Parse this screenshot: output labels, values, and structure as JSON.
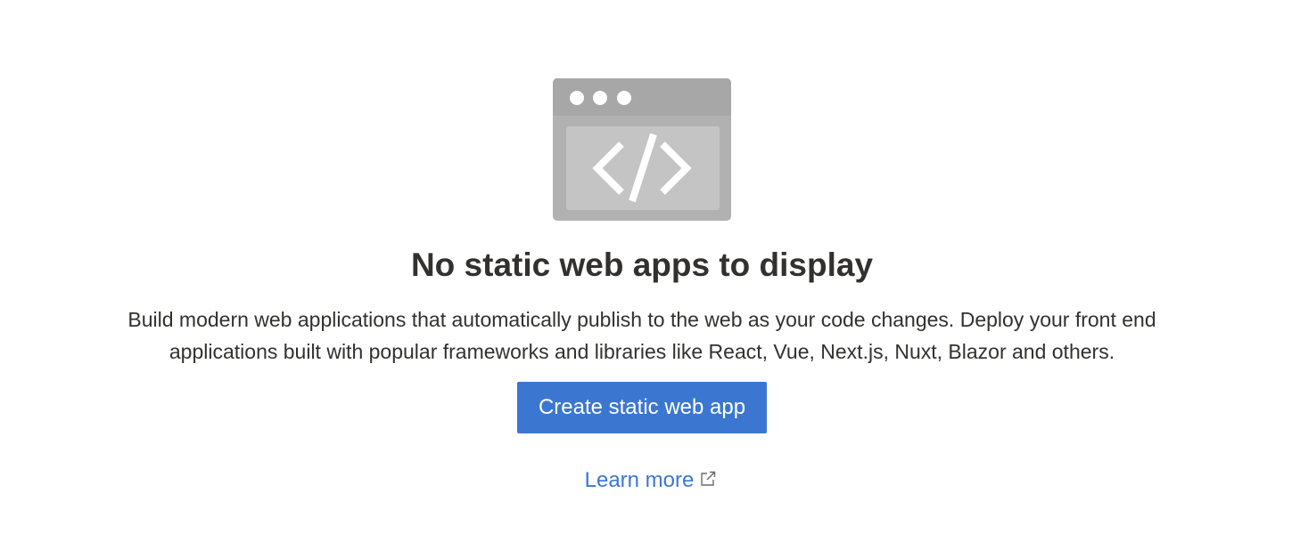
{
  "empty_state": {
    "illustration_icon": "browser-window-code-icon",
    "heading": "No static web apps to display",
    "description_line1": "Build modern web applications that automatically publish to the web as your code changes. Deploy your front end",
    "description_line2": "applications built with popular frameworks and libraries like React, Vue, Next.js, Nuxt, Blazor and others.",
    "create_button_label": "Create static web app",
    "learn_more_label": "Learn more",
    "learn_more_icon": "external-link-icon"
  },
  "colors": {
    "accent": "#3b77d0",
    "text": "#323130",
    "illustration_frame": "#a7a7a7",
    "illustration_body": "#b1b1b1",
    "illustration_panel": "#c4c4c4"
  }
}
